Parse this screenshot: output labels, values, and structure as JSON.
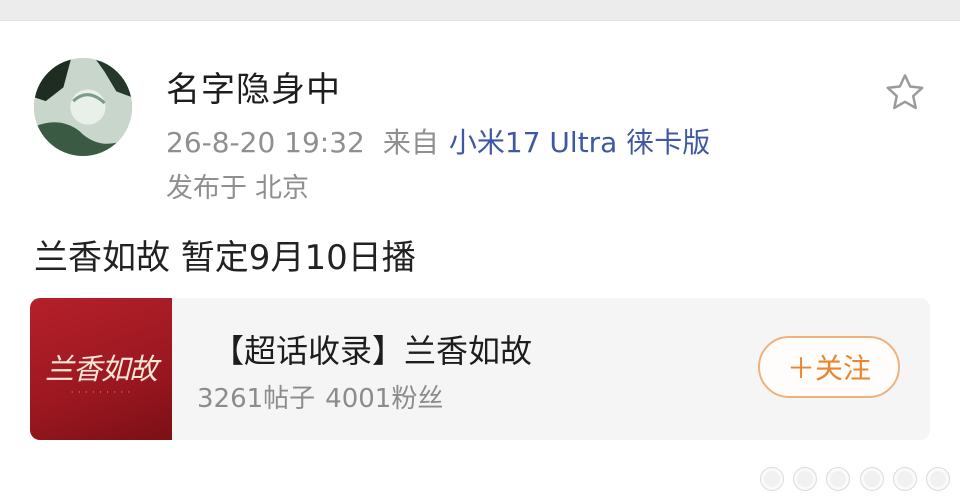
{
  "post": {
    "username": "名字隐身中",
    "time": "26-8-20 19:32",
    "source_prefix": "来自",
    "device": "小米17 Ultra 徕卡版",
    "location_prefix": "发布于",
    "location": "北京",
    "text": "兰香如故 暂定9月10日播"
  },
  "topic_card": {
    "image_title": "兰香如故",
    "title": "【超话收录】兰香如故",
    "posts": "3261帖子",
    "fans": "4001粉丝",
    "follow_label": "＋关注"
  },
  "icons": {
    "favorite": "star-outline-icon",
    "more": "more-dots-icon"
  },
  "colors": {
    "link_blue": "#3f58a5",
    "follow_orange": "#e9852e",
    "topic_red": "#b5202a"
  }
}
